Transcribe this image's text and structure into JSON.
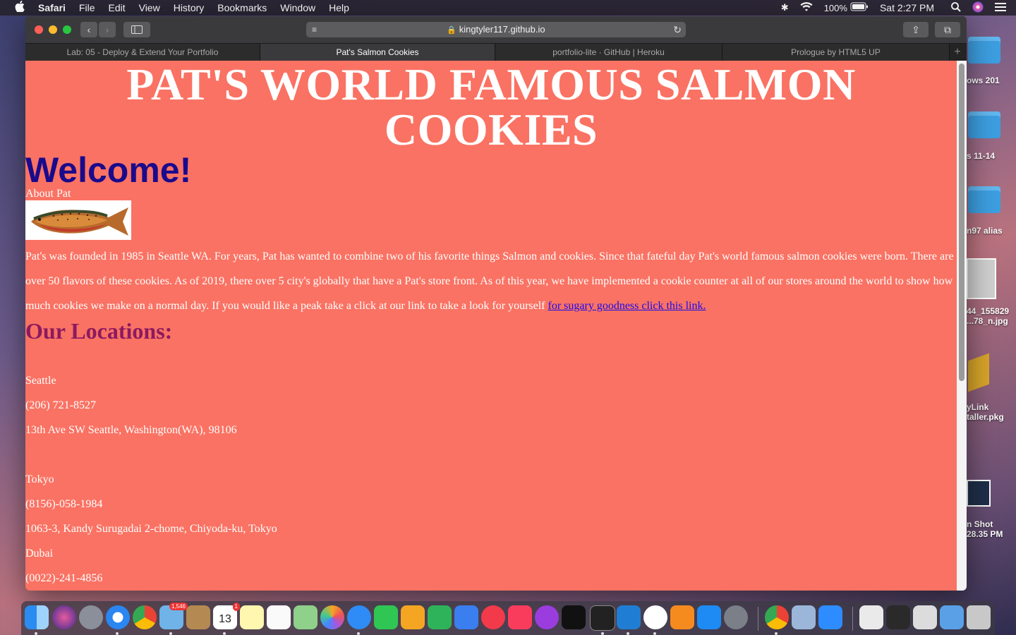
{
  "menubar": {
    "app": "Safari",
    "items": [
      "File",
      "Edit",
      "View",
      "History",
      "Bookmarks",
      "Window",
      "Help"
    ],
    "battery": "100%",
    "time": "Sat 2:27 PM"
  },
  "desktop": {
    "items": [
      {
        "label": "ows 201"
      },
      {
        "label": "s 11-14"
      },
      {
        "label": "n97 alias"
      },
      {
        "label": "44_155829\n...78_n.jpg"
      },
      {
        "label": "yLink\ntaller.pkg"
      },
      {
        "label": "n Shot\n28.35 PM"
      }
    ]
  },
  "browser": {
    "url": "kingtyler117.github.io",
    "tabs": [
      {
        "label": "Lab: 05 - Deploy & Extend Your Portfolio",
        "active": false
      },
      {
        "label": "Pat's Salmon Cookies",
        "active": true
      },
      {
        "label": "portfolio-lite · GitHub | Heroku",
        "active": false
      },
      {
        "label": "Prologue by HTML5 UP",
        "active": false
      }
    ]
  },
  "page": {
    "heading": "PAT'S WORLD FAMOUS SALMON COOKIES",
    "welcome": "Welcome!",
    "about": "About Pat",
    "paragraph": "Pat's was founded in 1985 in Seattle WA. For years, Pat has wanted to combine two of his favorite things Salmon and cookies. Since that fateful day Pat's world famous salmon cookies were born. There are over 50 flavors of these cookies. As of 2019, there over 5 city's globally that have a Pat's store front. As of this year, we have implemented a cookie counter at all of our stores around the world to show how much cookies we make on a normal day. If you would like a peak take a click at our link to take a look for yourself",
    "link": "for sugary goodness click this link.",
    "locations_title": "Our Locations:",
    "locations": [
      {
        "city": "Seattle",
        "phone": "(206) 721-8527",
        "address": "13th Ave SW Seattle, Washington(WA), 98106"
      },
      {
        "city": "Tokyo",
        "phone": "(8156)-058-1984",
        "address": "1063-3, Kandy Surugadai 2-chome, Chiyoda-ku, Tokyo"
      },
      {
        "city": "Dubai",
        "phone": "(0022)-241-4856"
      }
    ],
    "background_color": "#fa7263"
  },
  "dock": {
    "badges": {
      "mail": "1,546",
      "calendar": "1",
      "calendar_day": "13"
    }
  }
}
